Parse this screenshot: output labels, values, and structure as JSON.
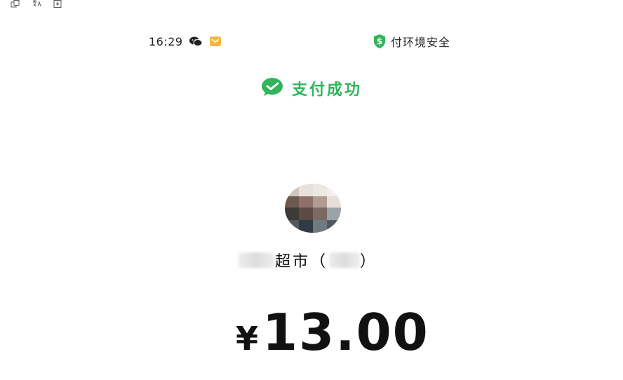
{
  "toolbar": {
    "icons": [
      "copy-icon",
      "translate-icon",
      "download-icon"
    ]
  },
  "status_bar": {
    "time": "16:29",
    "secure_text": "付环境安全",
    "colors": {
      "shield": "#31b45a",
      "mail": "#f3b642"
    }
  },
  "payment": {
    "success_text": "支付成功",
    "merchant_text": "超市（",
    "merchant_close": "）",
    "currency_symbol": "¥",
    "amount": "13.00"
  },
  "colors": {
    "accent": "#31b45a",
    "text": "#111111"
  }
}
